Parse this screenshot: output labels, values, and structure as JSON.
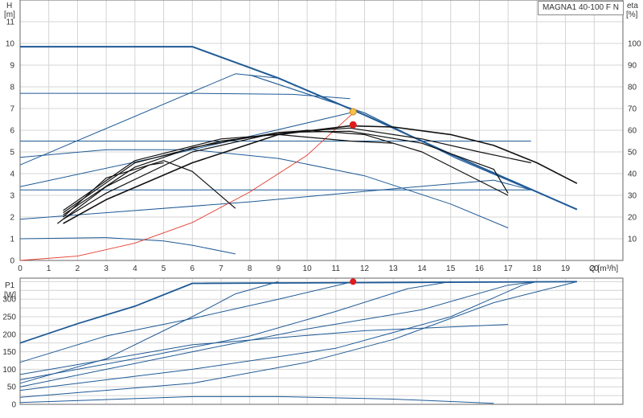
{
  "model": "MAGNA1 40-100 F N",
  "chart_data": [
    {
      "type": "line",
      "title": "",
      "xlabel": "Q [m³/h]",
      "ylabel": "H [m]",
      "y2label": "eta [%]",
      "xlim": [
        0,
        21
      ],
      "ylim": [
        0,
        12
      ],
      "y2lim": [
        0,
        120
      ],
      "grid": true,
      "x_ticks": [
        0,
        1,
        2,
        3,
        4,
        5,
        6,
        7,
        8,
        9,
        10,
        11,
        12,
        13,
        14,
        15,
        16,
        17,
        18,
        19,
        20
      ],
      "y_ticks": [
        0,
        1,
        2,
        3,
        4,
        5,
        6,
        7,
        8,
        9,
        10,
        11
      ],
      "y2_ticks": [
        10,
        20,
        30,
        40,
        50,
        60,
        70,
        80,
        90,
        100
      ],
      "x_unit_label": "Q [m³/h]",
      "y_labels": [
        "H",
        "[m]"
      ],
      "y2_labels": [
        "eta",
        "[%]"
      ],
      "series": [
        {
          "role": "head-max",
          "color": "#1f5a96",
          "width": 2,
          "points": [
            [
              0,
              9.85
            ],
            [
              6,
              9.85
            ],
            [
              9,
              8.4
            ],
            [
              12,
              6.7
            ],
            [
              15,
              4.9
            ],
            [
              19.4,
              2.35
            ]
          ]
        },
        {
          "role": "head-max-2",
          "color": "#1f5a96",
          "width": 1.2,
          "points": [
            [
              8,
              8.55
            ],
            [
              12,
              6.8
            ],
            [
              15.2,
              4.7
            ],
            [
              17.8,
              3.25
            ]
          ]
        },
        {
          "role": "head",
          "color": "#1f5a96",
          "width": 1,
          "points": [
            [
              0,
              4.4
            ],
            [
              7.5,
              8.6
            ],
            [
              9,
              8.4
            ]
          ]
        },
        {
          "role": "head",
          "color": "#1f5a96",
          "width": 1,
          "points": [
            [
              0,
              7.7
            ],
            [
              6,
              7.7
            ],
            [
              9.5,
              7.65
            ],
            [
              11.5,
              7.45
            ]
          ]
        },
        {
          "role": "head",
          "color": "#1f5a96",
          "width": 1,
          "points": [
            [
              0,
              3.4
            ],
            [
              6,
              5.1
            ],
            [
              11.5,
              6.8
            ]
          ]
        },
        {
          "role": "head",
          "color": "#1f5a96",
          "width": 1,
          "points": [
            [
              0,
              5.5
            ],
            [
              17.8,
              5.5
            ]
          ]
        },
        {
          "role": "head",
          "color": "#1f5a96",
          "width": 1,
          "points": [
            [
              0,
              4.75
            ],
            [
              3,
              5.1
            ],
            [
              6,
              5.1
            ],
            [
              9,
              4.7
            ],
            [
              12,
              3.9
            ],
            [
              15,
              2.6
            ],
            [
              17,
              1.5
            ]
          ]
        },
        {
          "role": "head",
          "color": "#1f5a96",
          "width": 1,
          "points": [
            [
              0,
              3.25
            ],
            [
              17.8,
              3.25
            ]
          ]
        },
        {
          "role": "head",
          "color": "#1f5a96",
          "width": 1,
          "points": [
            [
              0,
              1.9
            ],
            [
              8,
              2.7
            ],
            [
              13,
              3.3
            ],
            [
              16.5,
              3.7
            ],
            [
              17.8,
              3.25
            ]
          ]
        },
        {
          "role": "head",
          "color": "#1f5a96",
          "width": 1,
          "points": [
            [
              0,
              1.0
            ],
            [
              3,
              1.05
            ],
            [
              5,
              0.9
            ],
            [
              6,
              0.7
            ],
            [
              7.5,
              0.3
            ]
          ]
        },
        {
          "role": "system",
          "color": "#e33b2e",
          "width": 0.9,
          "points": [
            [
              0,
              0
            ],
            [
              2,
              0.2
            ],
            [
              4,
              0.8
            ],
            [
              6,
              1.75
            ],
            [
              8,
              3.15
            ],
            [
              10,
              4.85
            ],
            [
              11.65,
              6.85
            ]
          ]
        },
        {
          "role": "eta",
          "color": "#111111",
          "width": 1.6,
          "points": [
            [
              1.5,
              17
            ],
            [
              3,
              28
            ],
            [
              6,
              45
            ],
            [
              9,
              58
            ],
            [
              11.5,
              62
            ],
            [
              13,
              61.5
            ],
            [
              15,
              58
            ],
            [
              16.5,
              53
            ],
            [
              18,
              45
            ],
            [
              19.4,
              35.5
            ]
          ]
        },
        {
          "role": "eta",
          "color": "#111111",
          "width": 1.2,
          "points": [
            [
              1.5,
              19
            ],
            [
              3,
              31
            ],
            [
              6,
              50
            ],
            [
              9,
              59
            ],
            [
              11.5,
              61
            ],
            [
              14,
              56
            ],
            [
              16,
              50
            ],
            [
              17.8,
              45
            ]
          ]
        },
        {
          "role": "eta",
          "color": "#111111",
          "width": 1.2,
          "points": [
            [
              1.5,
              21
            ],
            [
              4,
              43
            ],
            [
              6,
              52
            ],
            [
              9,
              59
            ],
            [
              11.5,
              59.5
            ],
            [
              14,
              54
            ],
            [
              16.5,
              42
            ],
            [
              17,
              31
            ]
          ]
        },
        {
          "role": "eta",
          "color": "#111111",
          "width": 1.2,
          "points": [
            [
              1.5,
              22
            ],
            [
              4,
              45
            ],
            [
              7,
              55
            ],
            [
              10,
              60
            ],
            [
              12,
              58
            ],
            [
              14,
              50
            ],
            [
              15.5,
              40
            ],
            [
              17,
              30
            ]
          ]
        },
        {
          "role": "eta",
          "color": "#111111",
          "width": 1.2,
          "points": [
            [
              1.5,
              23
            ],
            [
              4,
              46
            ],
            [
              7,
              56
            ],
            [
              9,
              58
            ],
            [
              11.5,
              55
            ],
            [
              13,
              54
            ]
          ]
        },
        {
          "role": "eta",
          "color": "#111111",
          "width": 1.2,
          "points": [
            [
              1.5,
              20
            ],
            [
              3,
              38
            ],
            [
              5,
              46
            ],
            [
              6,
              41
            ],
            [
              7.5,
              24
            ]
          ]
        },
        {
          "role": "eta",
          "color": "#111111",
          "width": 1.2,
          "points": [
            [
              1.3,
              17
            ],
            [
              3,
              34
            ],
            [
              4.5,
              44
            ],
            [
              5,
              45
            ]
          ]
        }
      ],
      "markers": [
        {
          "role": "operating-point",
          "x": 11.6,
          "y": 6.85,
          "color": "#f6c24c",
          "stroke": "#d98a1a"
        },
        {
          "role": "eta-point",
          "x": 11.6,
          "y2": 62.5,
          "color": "#e01b1b"
        }
      ]
    },
    {
      "type": "line",
      "title": "",
      "xlabel": "",
      "ylabel": "P1 [W]",
      "xlim": [
        0,
        21
      ],
      "ylim": [
        0,
        360
      ],
      "grid": true,
      "y_ticks": [
        0,
        50,
        100,
        150,
        200,
        250,
        300
      ],
      "y_labels": [
        "P1",
        "[W]"
      ],
      "series": [
        {
          "role": "power-max",
          "color": "#1f5a96",
          "width": 1.8,
          "points": [
            [
              0,
              175
            ],
            [
              2,
              230
            ],
            [
              4,
              280
            ],
            [
              6,
              345
            ],
            [
              19.4,
              350
            ]
          ]
        },
        {
          "role": "power",
          "color": "#1f5a96",
          "width": 1,
          "points": [
            [
              0,
              60
            ],
            [
              3,
              130
            ],
            [
              6,
              250
            ],
            [
              7.5,
              315
            ],
            [
              9,
              350
            ]
          ]
        },
        {
          "role": "power",
          "color": "#1f5a96",
          "width": 1,
          "points": [
            [
              0,
              120
            ],
            [
              3,
              195
            ],
            [
              6,
              245
            ],
            [
              9,
              300
            ],
            [
              11.6,
              350
            ]
          ]
        },
        {
          "role": "power",
          "color": "#1f5a96",
          "width": 1,
          "points": [
            [
              0,
              70
            ],
            [
              4,
              130
            ],
            [
              8,
              195
            ],
            [
              11,
              265
            ],
            [
              13.5,
              330
            ],
            [
              15,
              350
            ]
          ]
        },
        {
          "role": "power",
          "color": "#1f5a96",
          "width": 1,
          "points": [
            [
              0,
              50
            ],
            [
              6,
              150
            ],
            [
              10,
              215
            ],
            [
              14,
              270
            ],
            [
              17,
              340
            ],
            [
              18,
              350
            ]
          ]
        },
        {
          "role": "power",
          "color": "#1f5a96",
          "width": 1,
          "points": [
            [
              0,
              85
            ],
            [
              6,
              170
            ],
            [
              12,
              210
            ],
            [
              17,
              228
            ]
          ]
        },
        {
          "role": "power",
          "color": "#1f5a96",
          "width": 1,
          "points": [
            [
              0,
              40
            ],
            [
              6,
              100
            ],
            [
              11,
              160
            ],
            [
              15,
              250
            ],
            [
              17.5,
              340
            ],
            [
              18,
              350
            ]
          ]
        },
        {
          "role": "power",
          "color": "#1f5a96",
          "width": 1,
          "points": [
            [
              0,
              20
            ],
            [
              6,
              60
            ],
            [
              10,
              120
            ],
            [
              13,
              185
            ],
            [
              16.5,
              290
            ],
            [
              19.4,
              350
            ]
          ]
        },
        {
          "role": "power",
          "color": "#1f5a96",
          "width": 1,
          "points": [
            [
              0,
              5
            ],
            [
              6,
              22
            ],
            [
              9,
              22
            ],
            [
              13,
              15
            ],
            [
              16.5,
              3
            ]
          ]
        }
      ],
      "markers": [
        {
          "role": "power-point",
          "x": 11.6,
          "y": 350,
          "color": "#e01b1b"
        }
      ]
    }
  ]
}
